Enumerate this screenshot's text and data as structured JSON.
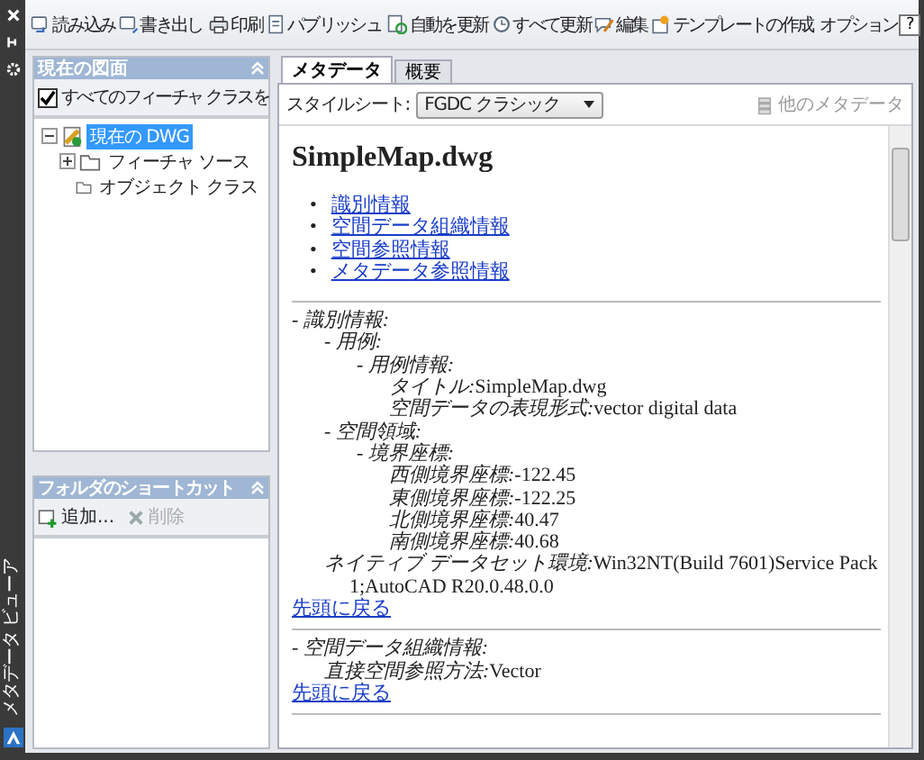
{
  "side_strip": {
    "title": "メタデータ ビューア"
  },
  "toolbar": {
    "items": [
      {
        "label": "読み込み"
      },
      {
        "label": "書き出し"
      },
      {
        "label": "印刷"
      },
      {
        "label": "パブリッシュ"
      },
      {
        "label": "自動を更新"
      },
      {
        "label": "すべて更新"
      },
      {
        "label": "編集"
      },
      {
        "label": "テンプレートの作成"
      },
      {
        "label": "オプション"
      }
    ],
    "help": "?"
  },
  "drawing_panel": {
    "title": "現在の図面",
    "checkbox": {
      "label": "すべてのフィーチャ クラスを",
      "checked": true
    },
    "tree": [
      {
        "label": "現在の DWG",
        "selected": true,
        "expanded": true,
        "children": [
          {
            "label": "フィーチャ ソース",
            "selected": false,
            "expanded": false
          },
          {
            "label": "オブジェクト クラス",
            "selected": false
          }
        ]
      }
    ]
  },
  "shortcut_panel": {
    "title": "フォルダのショートカット",
    "buttons": [
      {
        "label": "追加...",
        "disabled": false
      },
      {
        "label": "削除",
        "disabled": true
      }
    ]
  },
  "tabs": [
    {
      "label": "メタデータ",
      "selected": true
    },
    {
      "label": "概要",
      "selected": false
    }
  ],
  "stylesheet": {
    "label": "スタイルシート:",
    "value": "FGDC クラシック"
  },
  "other_metadata": {
    "label": "他のメタデータ",
    "disabled": true
  },
  "document": {
    "title": "SimpleMap.dwg",
    "links": [
      {
        "bullet": "•",
        "label": "識別情報"
      },
      {
        "bullet": "•",
        "label": "空間データ組織情報"
      },
      {
        "bullet": "•",
        "label": "空間参照情報"
      },
      {
        "bullet": "•",
        "label": "メタデータ参照情報"
      }
    ],
    "sections": [
      {
        "entries": [
          {
            "label": "- 識別情報:",
            "children": [
              {
                "label": "- 用例:",
                "children": [
                  {
                    "label": "- 用例情報:",
                    "children": [
                      {
                        "label": "タイトル:",
                        "value": "SimpleMap.dwg"
                      },
                      {
                        "label": "空間データの表現形式:",
                        "value": "vector digital data"
                      }
                    ]
                  }
                ]
              },
              {
                "label": "- 空間領域:",
                "children": [
                  {
                    "label": "- 境界座標:",
                    "children": [
                      {
                        "label": "西側境界座標:",
                        "value": "-122.45"
                      },
                      {
                        "label": "東側境界座標:",
                        "value": "-122.25"
                      },
                      {
                        "label": "北側境界座標:",
                        "value": "40.47"
                      },
                      {
                        "label": "南側境界座標:",
                        "value": "40.68"
                      }
                    ]
                  }
                ]
              },
              {
                "label": "ネイティブ データセット環境:",
                "value": "Win32NT(Build 7601)Service Pack 1;AutoCAD R20.0.48.0.0"
              }
            ]
          }
        ],
        "back_link": "先頭に戻る"
      },
      {
        "entries": [
          {
            "label": "- 空間データ組織情報:",
            "children": [
              {
                "label": "直接空間参照方法:",
                "value": "Vector"
              }
            ]
          }
        ],
        "back_link": "先頭に戻る"
      }
    ]
  }
}
